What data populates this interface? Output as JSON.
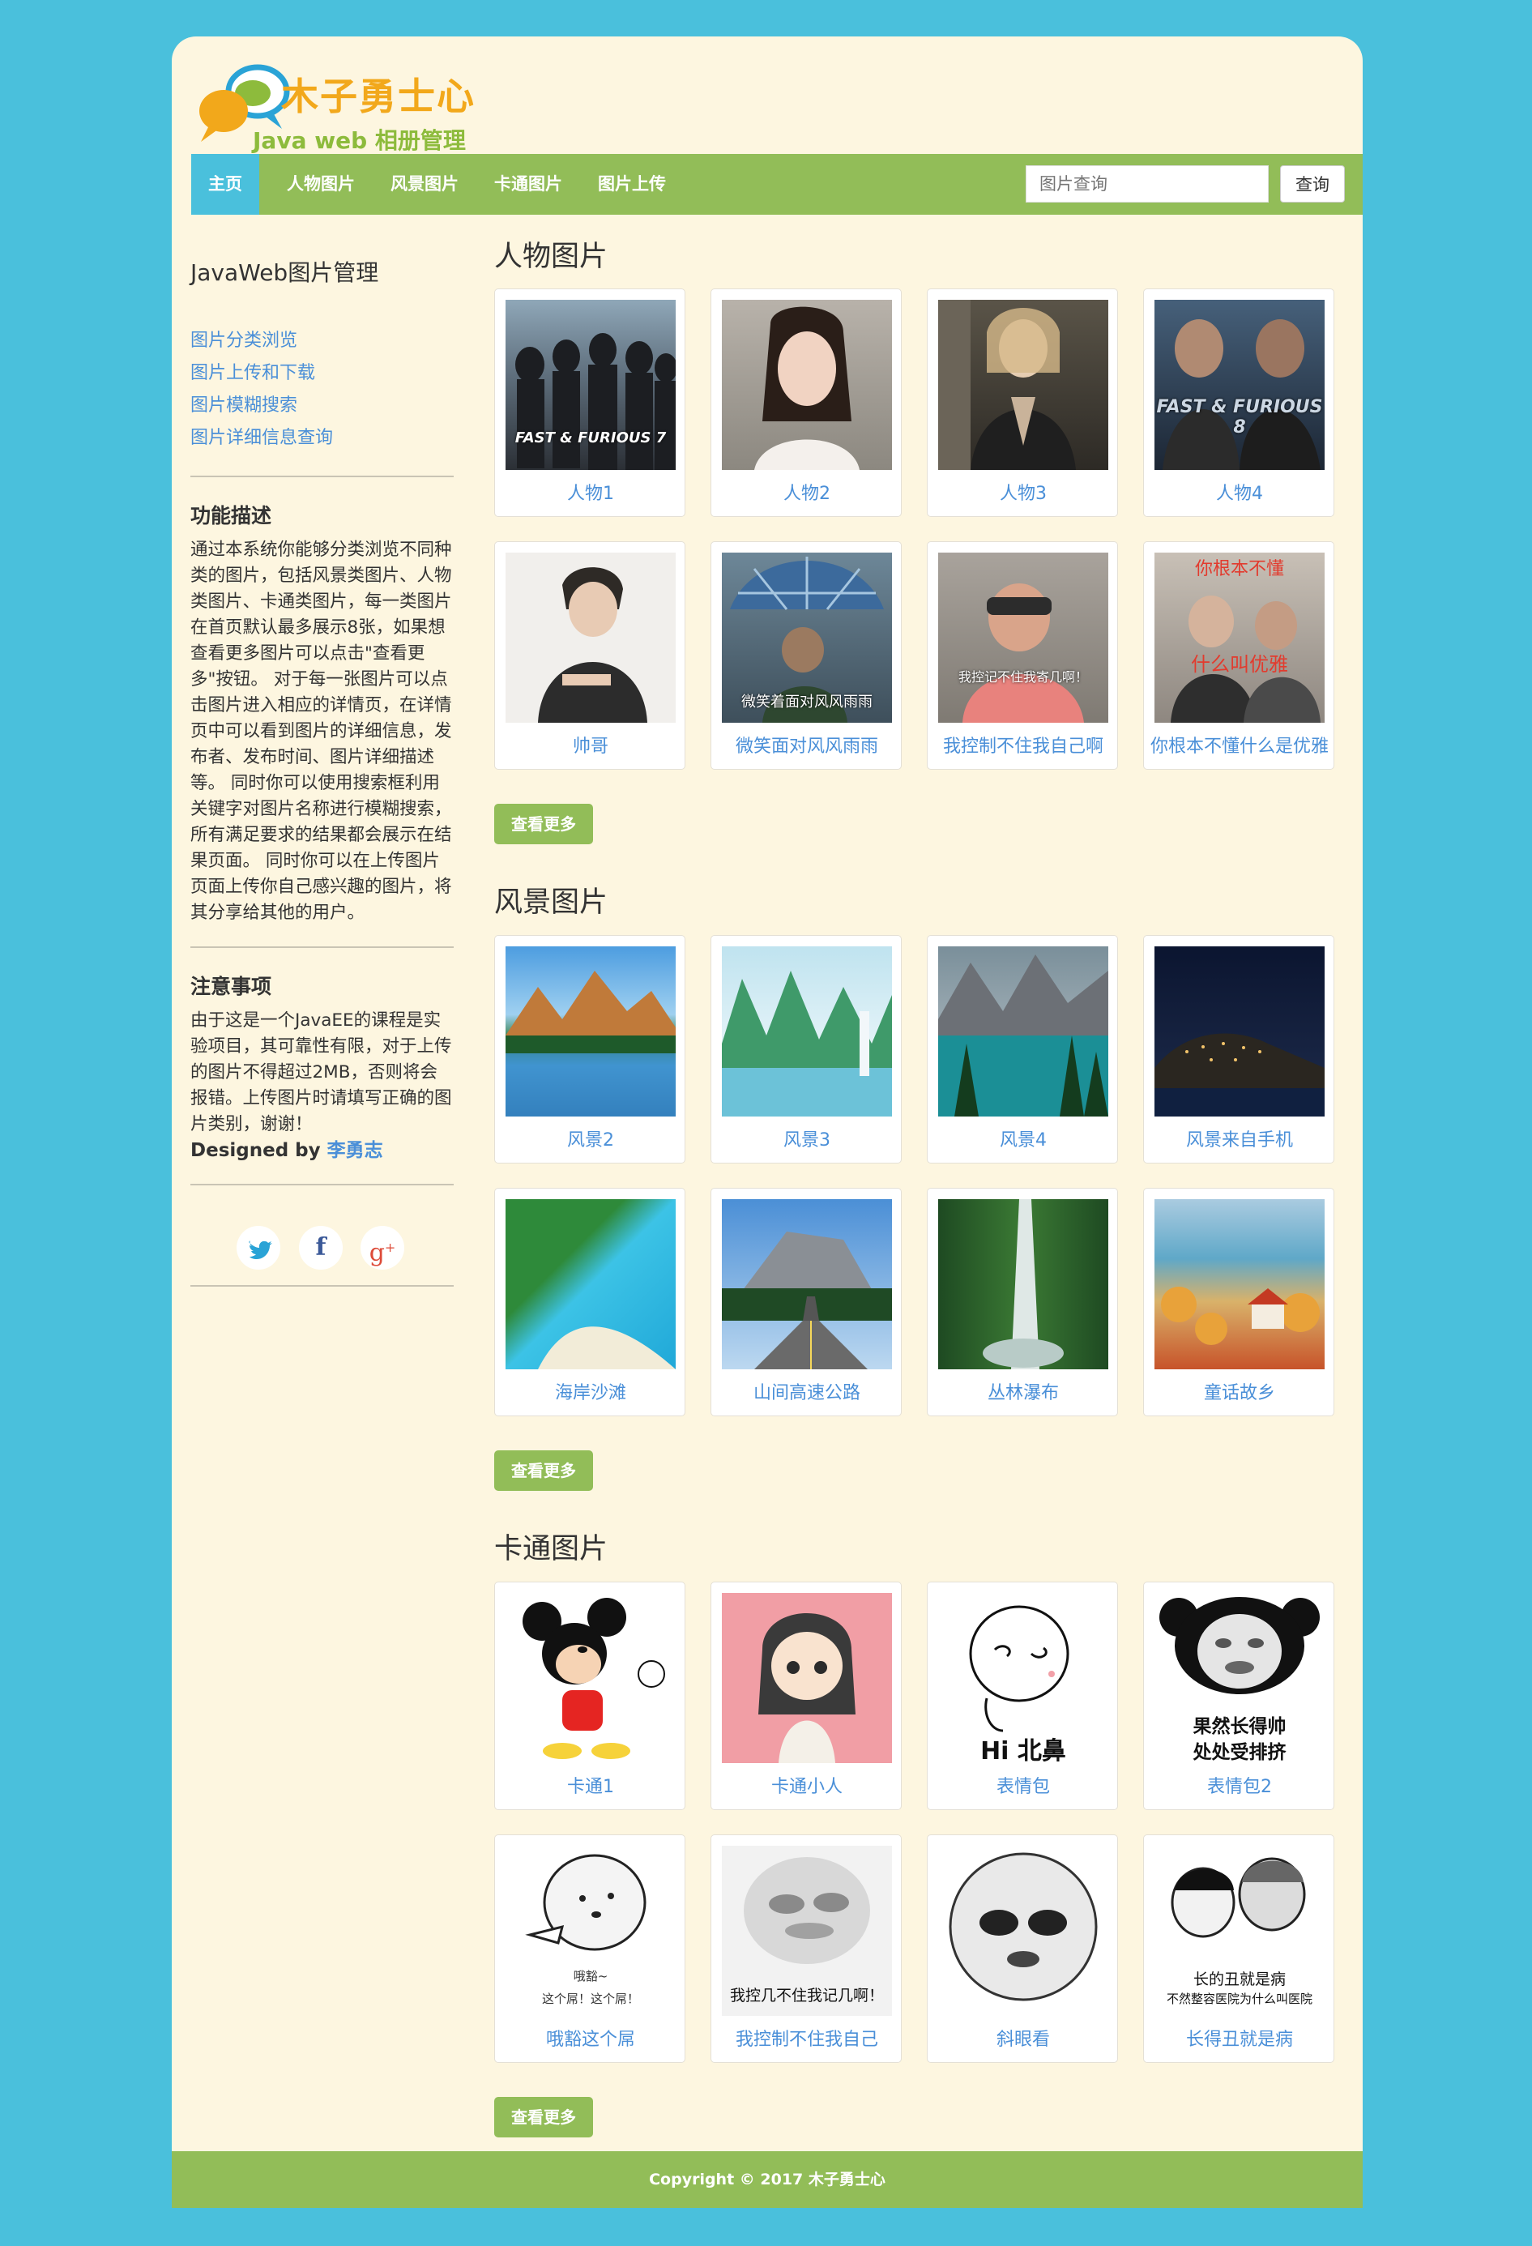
{
  "brand": {
    "title": "木子勇士心",
    "subtitle": "Java web 相册管理"
  },
  "nav": {
    "items": [
      "主页",
      "人物图片",
      "风景图片",
      "卡通图片",
      "图片上传"
    ],
    "active_index": 0,
    "search_placeholder": "图片查询",
    "search_button": "查询"
  },
  "sidebar": {
    "title": "JavaWeb图片管理",
    "links": [
      "图片分类浏览",
      "图片上传和下载",
      "图片模糊搜索",
      "图片详细信息查询"
    ],
    "feature_heading": "功能描述",
    "feature_text": "通过本系统你能够分类浏览不同种类的图片，包括风景类图片、人物类图片、卡通类图片，每一类图片在首页默认最多展示8张，如果想查看更多图片可以点击\"查看更多\"按钮。 对于每一张图片可以点击图片进入相应的详情页，在详情页中可以看到图片的详细信息，发布者、发布时间、图片详细描述等。 同时你可以使用搜索框利用关键字对图片名称进行模糊搜索，所有满足要求的结果都会展示在结果页面。 同时你可以在上传图片页面上传你自己感兴趣的图片，将其分享给其他的用户。",
    "notice_heading": "注意事项",
    "notice_text": "由于这是一个JavaEE的课程是实验项目，其可靠性有限，对于上传的图片不得超过2MB，否则将会报错。上传图片时请填写正确的图片类别，谢谢！",
    "designed_by_label": "Designed by",
    "designed_by_name": "李勇志",
    "social": [
      "twitter-icon",
      "facebook-icon",
      "google-plus-icon"
    ]
  },
  "sections": [
    {
      "title": "人物图片",
      "items": [
        "人物1",
        "人物2",
        "人物3",
        "人物4",
        "帅哥",
        "微笑面对风风雨雨",
        "我控制不住我自己啊",
        "你根本不懂什么是优雅"
      ],
      "more": "查看更多"
    },
    {
      "title": "风景图片",
      "items": [
        "风景2",
        "风景3",
        "风景4",
        "风景来自手机",
        "海岸沙滩",
        "山间高速公路",
        "丛林瀑布",
        "童话故乡"
      ],
      "more": "查看更多"
    },
    {
      "title": "卡通图片",
      "items": [
        "卡通1",
        "卡通小人",
        "表情包",
        "表情包2",
        "哦豁这个屌",
        "我控制不住我自己",
        "斜眼看",
        "长得丑就是病"
      ],
      "more": "查看更多"
    }
  ],
  "thumb_text": {
    "fast7": "FAST & FURIOUS 7",
    "fast8": "FAST & FURIOUS 8",
    "rain": "微笑着面对风风雨雨",
    "ctrl": "我控记不住我寄几啊！",
    "elegant_top": "你根本不懂",
    "elegant_bottom": "什么叫优雅",
    "hi": "Hi 北鼻",
    "handsome_1": "果然长得帅",
    "handsome_2": "处处受排挤",
    "ohuo_1": "哦豁~",
    "ohuo_2": "这个屌！这个屌！",
    "ctrl2": "我控几不住我记几啊！",
    "ugly_1": "长的丑就是病",
    "ugly_2": "不然整容医院为什么叫医院"
  },
  "footer": {
    "text": "Copyright © 2017 木子勇士心"
  }
}
